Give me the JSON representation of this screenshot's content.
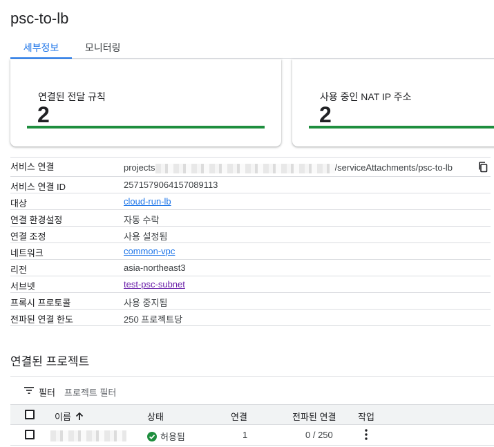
{
  "page": {
    "title": "psc-to-lb"
  },
  "tabs": [
    {
      "label": "세부정보",
      "active": true
    },
    {
      "label": "모니터링",
      "active": false
    }
  ],
  "cards": [
    {
      "label": "연결된 전달 규칙",
      "value": "2"
    },
    {
      "label": "사용 중인 NAT IP 주소",
      "value": "2"
    }
  ],
  "properties": {
    "service_attachment": {
      "key": "서비스 연결",
      "prefix": "projects",
      "suffix": "/serviceAttachments/psc-to-lb"
    },
    "service_attachment_id": {
      "key": "서비스 연결 ID",
      "value": "2571579064157089113"
    },
    "target": {
      "key": "대상",
      "value": "cloud-run-lb"
    },
    "connection_preference": {
      "key": "연결 환경설정",
      "value": "자동 수락"
    },
    "connection_reconcile": {
      "key": "연결 조정",
      "value": "사용 설정됨"
    },
    "network": {
      "key": "네트워크",
      "value": "common-vpc"
    },
    "region": {
      "key": "리전",
      "value": "asia-northeast3"
    },
    "subnet": {
      "key": "서브넷",
      "value": "test-psc-subnet"
    },
    "proxy_protocol": {
      "key": "프록시 프로토콜",
      "value": "사용 중지됨"
    },
    "propagated_limit": {
      "key": "전파된 연결 한도",
      "value": "250 프로젝트당"
    }
  },
  "connected_projects": {
    "title": "연결된 프로젝트",
    "filter_label": "필터",
    "filter_placeholder": "프로젝트 필터",
    "columns": {
      "name": "이름",
      "status": "상태",
      "connections": "연결",
      "propagated": "전파된 연결",
      "action": "작업"
    },
    "rows": [
      {
        "status": "허용됨",
        "connections": "1",
        "propagated": "0 / 250"
      }
    ]
  },
  "colors": {
    "accent": "#1a73e8",
    "success": "#1e8e3e",
    "visited_link": "#681da8"
  },
  "icons": [
    "copy-icon",
    "filter-icon",
    "sort-arrow-up-icon",
    "check-circle-icon",
    "more-vert-icon"
  ]
}
